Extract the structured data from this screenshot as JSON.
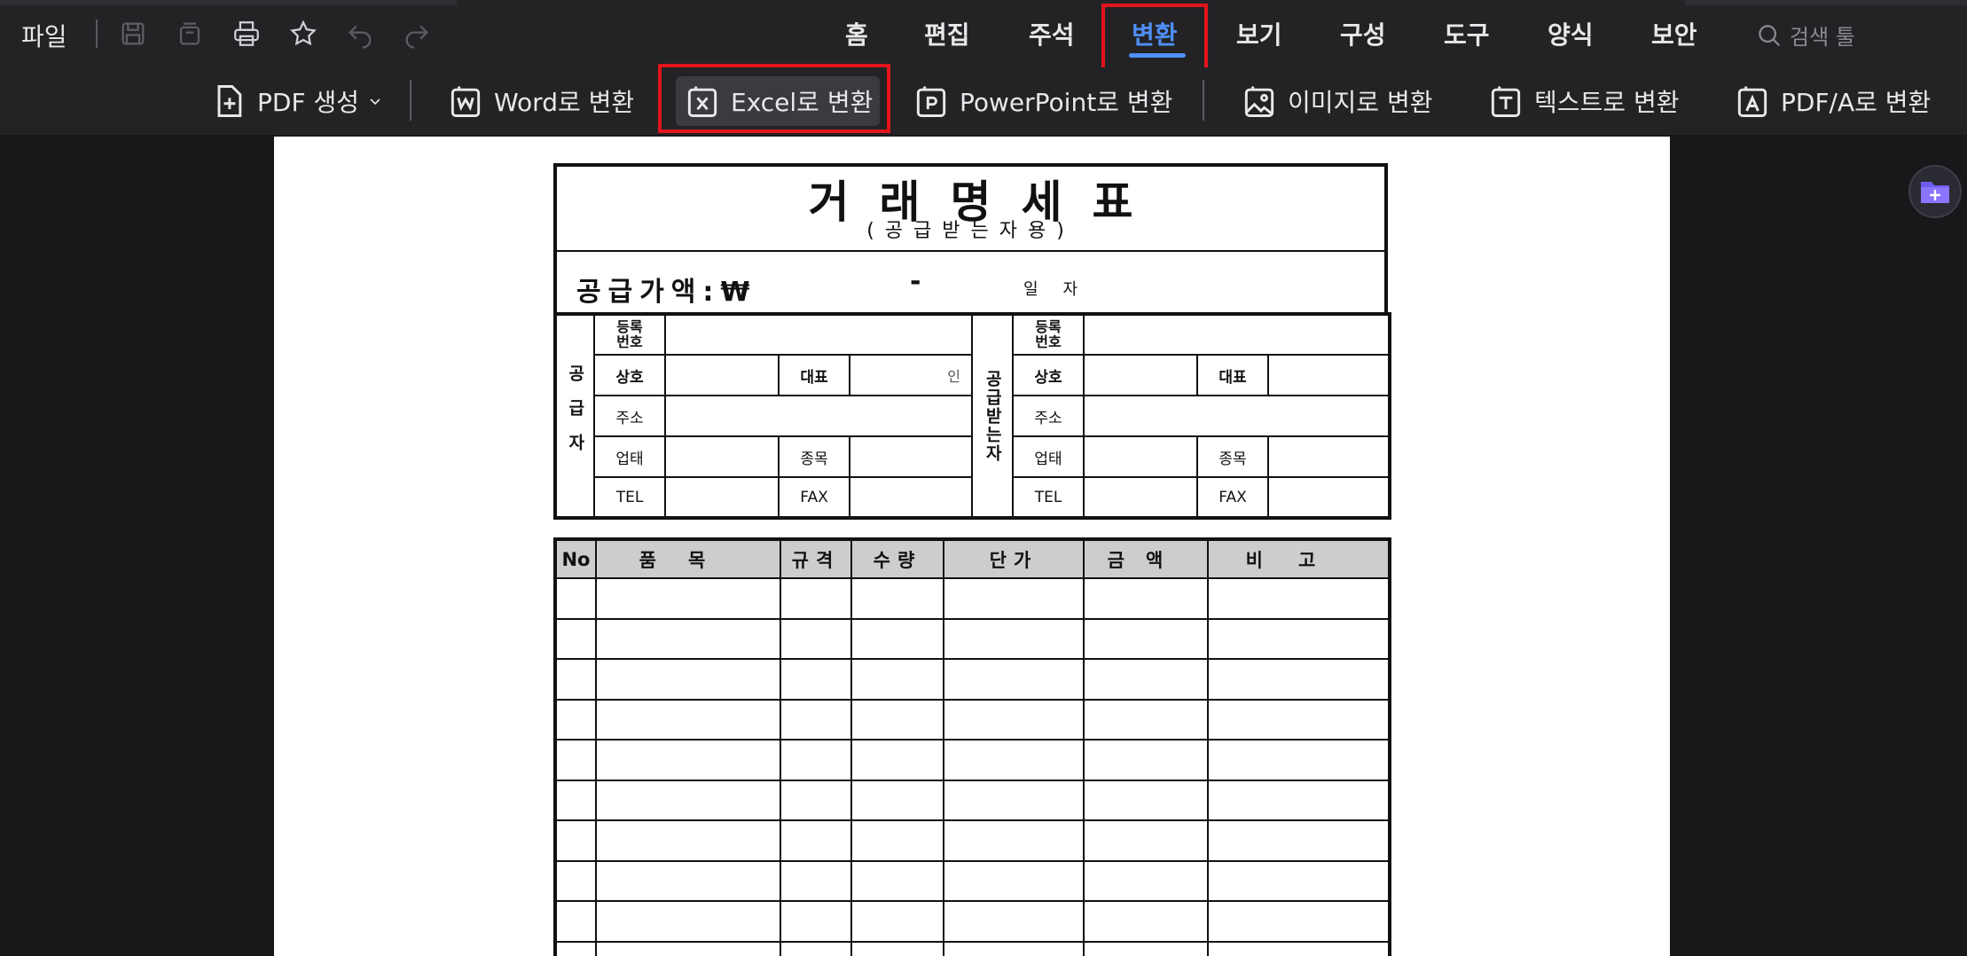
{
  "menu": {
    "file": "파일"
  },
  "tabs": [
    {
      "label": "홈"
    },
    {
      "label": "편집"
    },
    {
      "label": "주석"
    },
    {
      "label": "변환"
    },
    {
      "label": "보기"
    },
    {
      "label": "구성"
    },
    {
      "label": "도구"
    },
    {
      "label": "양식"
    },
    {
      "label": "보안"
    }
  ],
  "active_tab": "변환",
  "search": {
    "placeholder": "검색 툴"
  },
  "toolbar": {
    "create_pdf": "PDF 생성",
    "to_word": "Word로 변환",
    "to_excel": "Excel로 변환",
    "to_ppt": "PowerPoint로 변환",
    "to_image": "이미지로 변환",
    "to_text": "텍스트로 변환",
    "to_pdfa": "PDF/A로 변환"
  },
  "colors": {
    "accent": "#4f8ff7",
    "highlight": "#e3141c",
    "chrome": "#232326",
    "canvas": "#18181a"
  },
  "document": {
    "title": "거래명세표",
    "subtitle": "(공급받는자용)",
    "amount_label": "공급가액:₩",
    "amount_dash": "-",
    "date_label": "일자",
    "supplier_label": "공급자",
    "receiver_label": "공급받는자",
    "fields": {
      "reg_no_1": "등록",
      "reg_no_2": "번호",
      "company": "상호",
      "rep": "대표",
      "seal": "인",
      "address": "주소",
      "business": "업태",
      "item_type": "종목",
      "tel": "TEL",
      "fax": "FAX"
    },
    "item_headers": [
      "No",
      "품목",
      "규격",
      "수량",
      "단가",
      "금액",
      "비고"
    ]
  }
}
